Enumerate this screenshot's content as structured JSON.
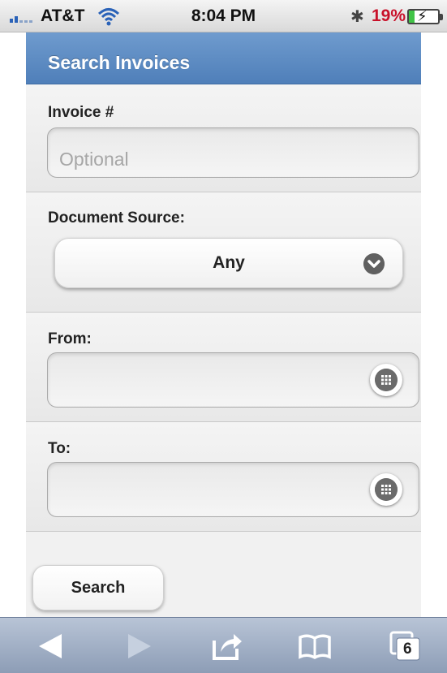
{
  "status_bar": {
    "carrier": "AT&T",
    "time": "8:04 PM",
    "battery_percent": "19%",
    "battery_level": 0.19,
    "icons": [
      "signal-icon",
      "wifi-icon",
      "bluetooth-icon",
      "battery-icon"
    ]
  },
  "page": {
    "title": "Search Invoices"
  },
  "invoice": {
    "label": "Invoice #",
    "placeholder": "Optional",
    "value": ""
  },
  "source": {
    "label": "Document Source:",
    "selected": "Any"
  },
  "from": {
    "label": "From:",
    "value": ""
  },
  "to": {
    "label": "To:",
    "value": ""
  },
  "actions": {
    "search_label": "Search"
  },
  "toolbar": {
    "tab_count": "6",
    "icons": [
      "back-icon",
      "forward-icon",
      "share-icon",
      "bookmarks-icon",
      "tabs-icon"
    ]
  },
  "colors": {
    "header": "#5b89c3",
    "battery_low": "#c8112a",
    "battery_fill": "#41c447",
    "toolbar": "#9fadc4"
  }
}
